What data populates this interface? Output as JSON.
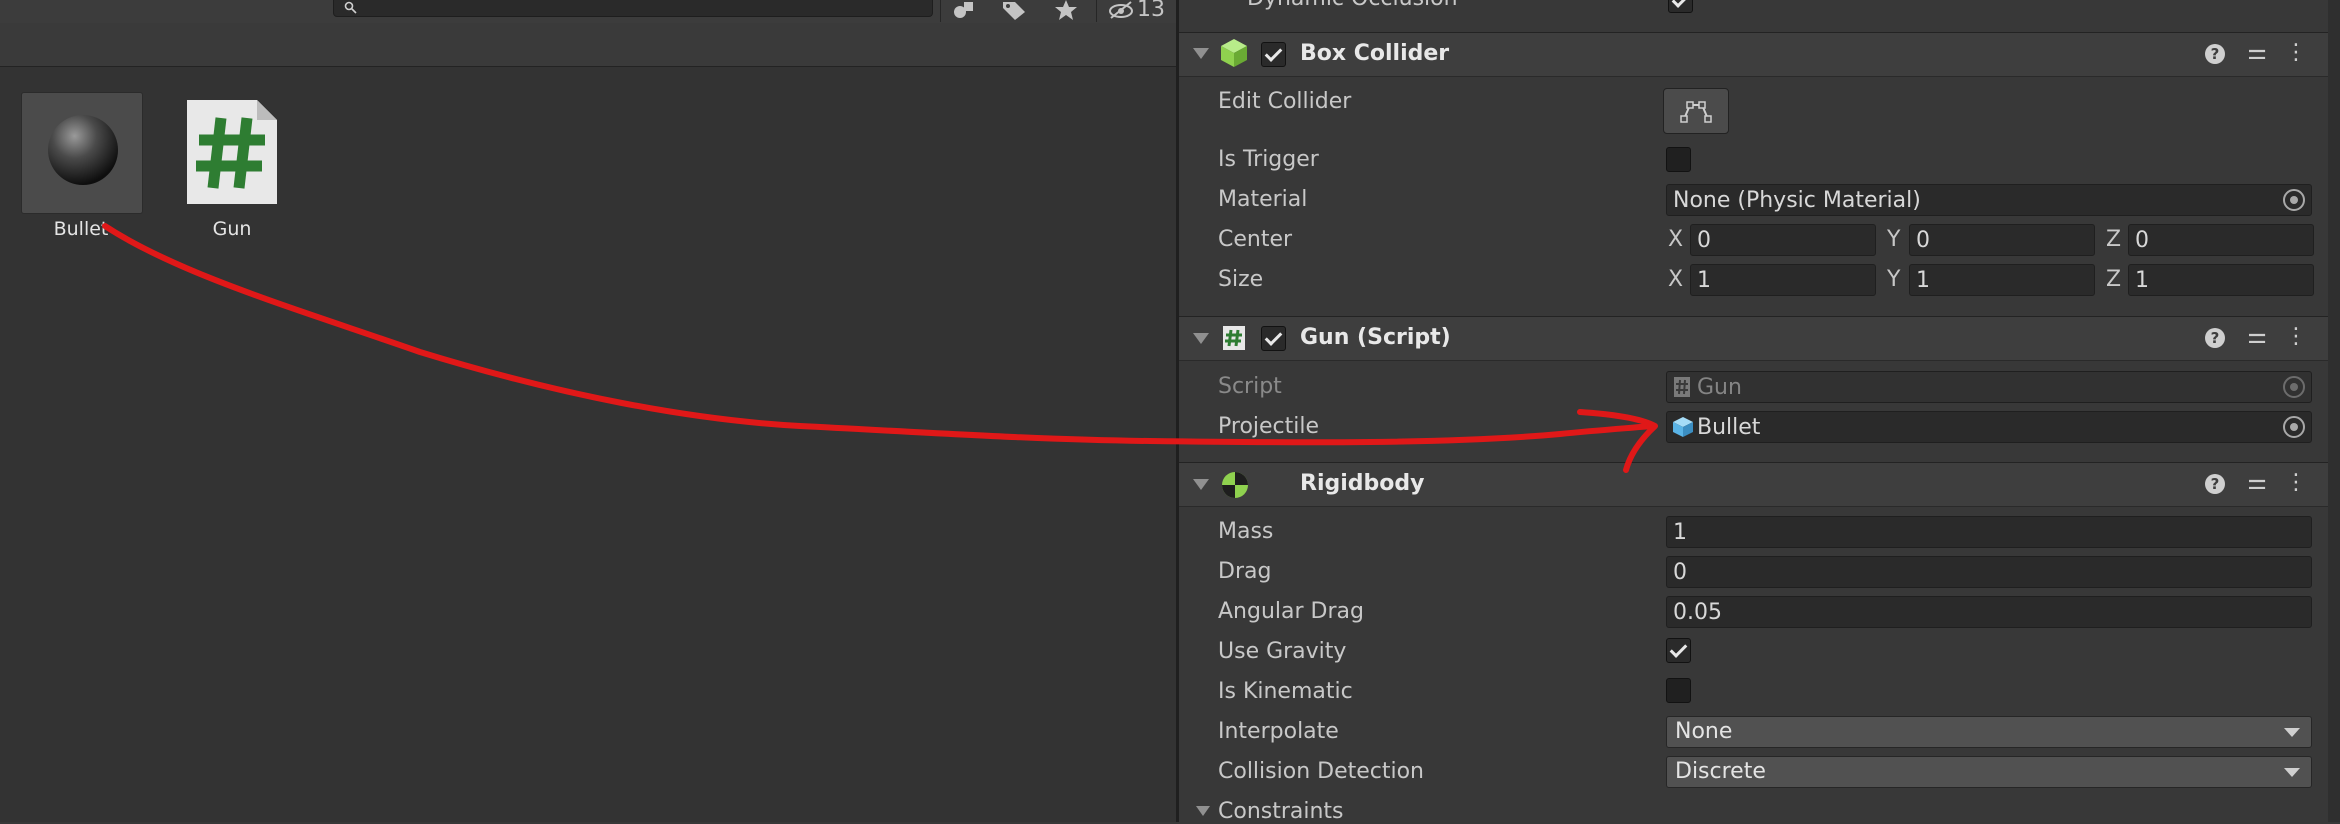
{
  "project": {
    "hidden_count": "13",
    "assets": [
      {
        "name": "Bullet",
        "icon": "sphere-prefab-icon"
      },
      {
        "name": "Gun",
        "icon": "csharp-script-icon"
      }
    ]
  },
  "inspector": {
    "prev_row_label": "Dynamic Occlusion",
    "box_collider": {
      "title": "Box Collider",
      "edit_collider_label": "Edit Collider",
      "is_trigger_label": "Is Trigger",
      "material_label": "Material",
      "material_value": "None (Physic Material)",
      "center_label": "Center",
      "center": {
        "x": "0",
        "y": "0",
        "z": "0"
      },
      "size_label": "Size",
      "size": {
        "x": "1",
        "y": "1",
        "z": "1"
      },
      "axis_x": "X",
      "axis_y": "Y",
      "axis_z": "Z"
    },
    "gun_script": {
      "title": "Gun (Script)",
      "script_label": "Script",
      "script_value": "Gun",
      "projectile_label": "Projectile",
      "projectile_value": "Bullet"
    },
    "rigidbody": {
      "title": "Rigidbody",
      "mass_label": "Mass",
      "mass": "1",
      "drag_label": "Drag",
      "drag": "0",
      "angular_drag_label": "Angular Drag",
      "angular_drag": "0.05",
      "use_gravity_label": "Use Gravity",
      "use_gravity": true,
      "is_kinematic_label": "Is Kinematic",
      "is_kinematic": false,
      "interpolate_label": "Interpolate",
      "interpolate": "None",
      "collision_detection_label": "Collision Detection",
      "collision_detection": "Discrete",
      "constraints_label": "Constraints"
    }
  },
  "colors": {
    "annotation_arrow": "#e01818",
    "rigidbody_icon": "#8fd14f",
    "box_collider_icon": "#8fd14f",
    "script_hash": "#2e7d32",
    "prefab_cube": "#5ab4e6"
  }
}
